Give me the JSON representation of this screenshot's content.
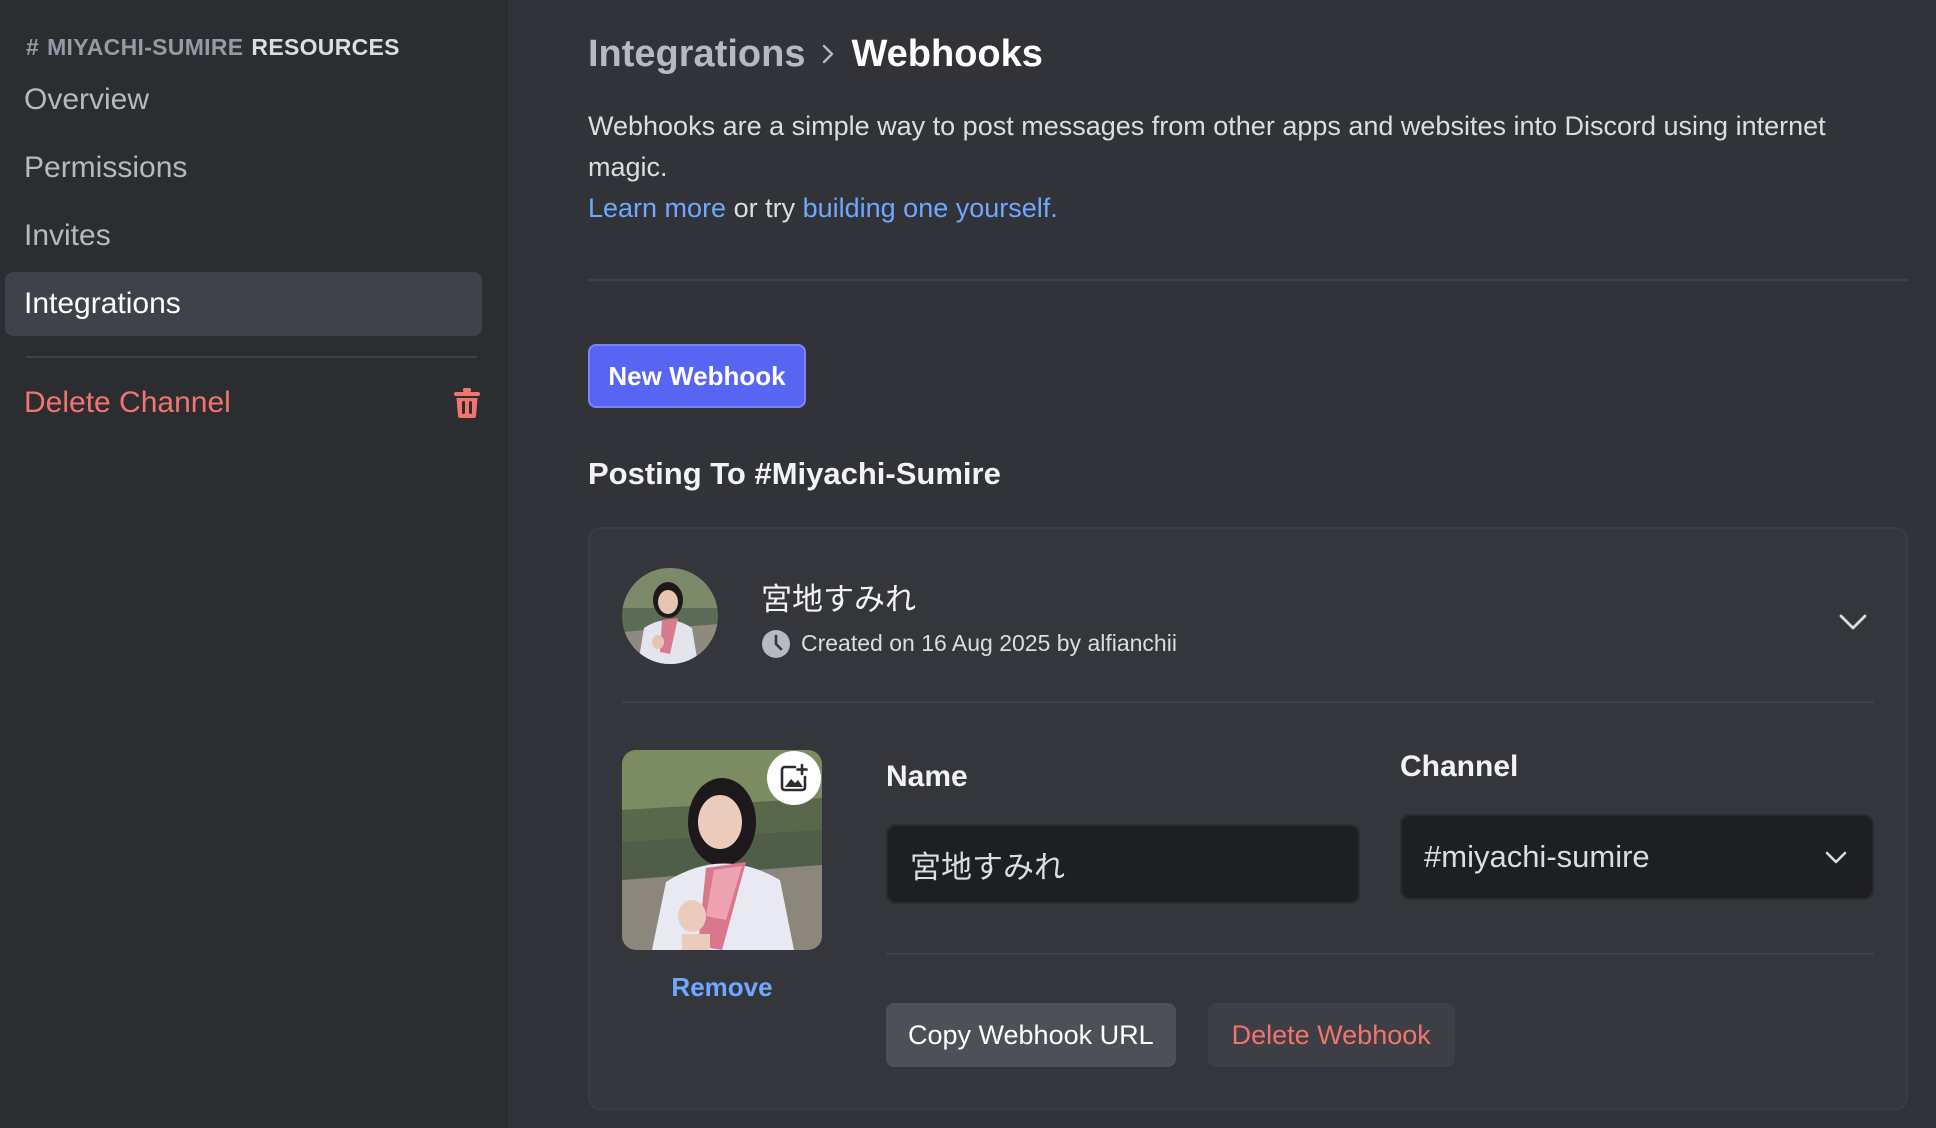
{
  "sidebar": {
    "header": {
      "hash": "#",
      "channel": "MIYACHI-SUMIRE",
      "suffix": "RESOURCES"
    },
    "items": [
      {
        "label": "Overview"
      },
      {
        "label": "Permissions"
      },
      {
        "label": "Invites"
      },
      {
        "label": "Integrations",
        "active": true
      }
    ],
    "delete_label": "Delete Channel"
  },
  "main": {
    "breadcrumb": {
      "parent": "Integrations",
      "current": "Webhooks"
    },
    "description": {
      "text": "Webhooks are a simple way to post messages from other apps and websites into Discord using internet magic.",
      "learn_more": "Learn more",
      "or_try": " or try ",
      "building": "building one yourself."
    },
    "new_webhook_label": "New Webhook",
    "posting_title": "Posting To #Miyachi-Sumire",
    "webhook": {
      "name": "宮地すみれ",
      "created": "Created on 16 Aug 2025 by alfianchii",
      "remove_label": "Remove",
      "name_label": "Name",
      "name_value": "宮地すみれ",
      "channel_label": "Channel",
      "channel_value": "#miyachi-sumire",
      "copy_url_label": "Copy Webhook URL",
      "delete_label": "Delete Webhook"
    }
  },
  "colors": {
    "accent": "#5865f2",
    "link": "#6fa8ff",
    "danger": "#f1746f",
    "sidebar_bg": "#2b2d31",
    "main_bg": "#323339"
  },
  "icons": [
    "trash-icon",
    "chevron-right-icon",
    "clock-icon",
    "chevron-down-icon",
    "image-plus-icon"
  ]
}
